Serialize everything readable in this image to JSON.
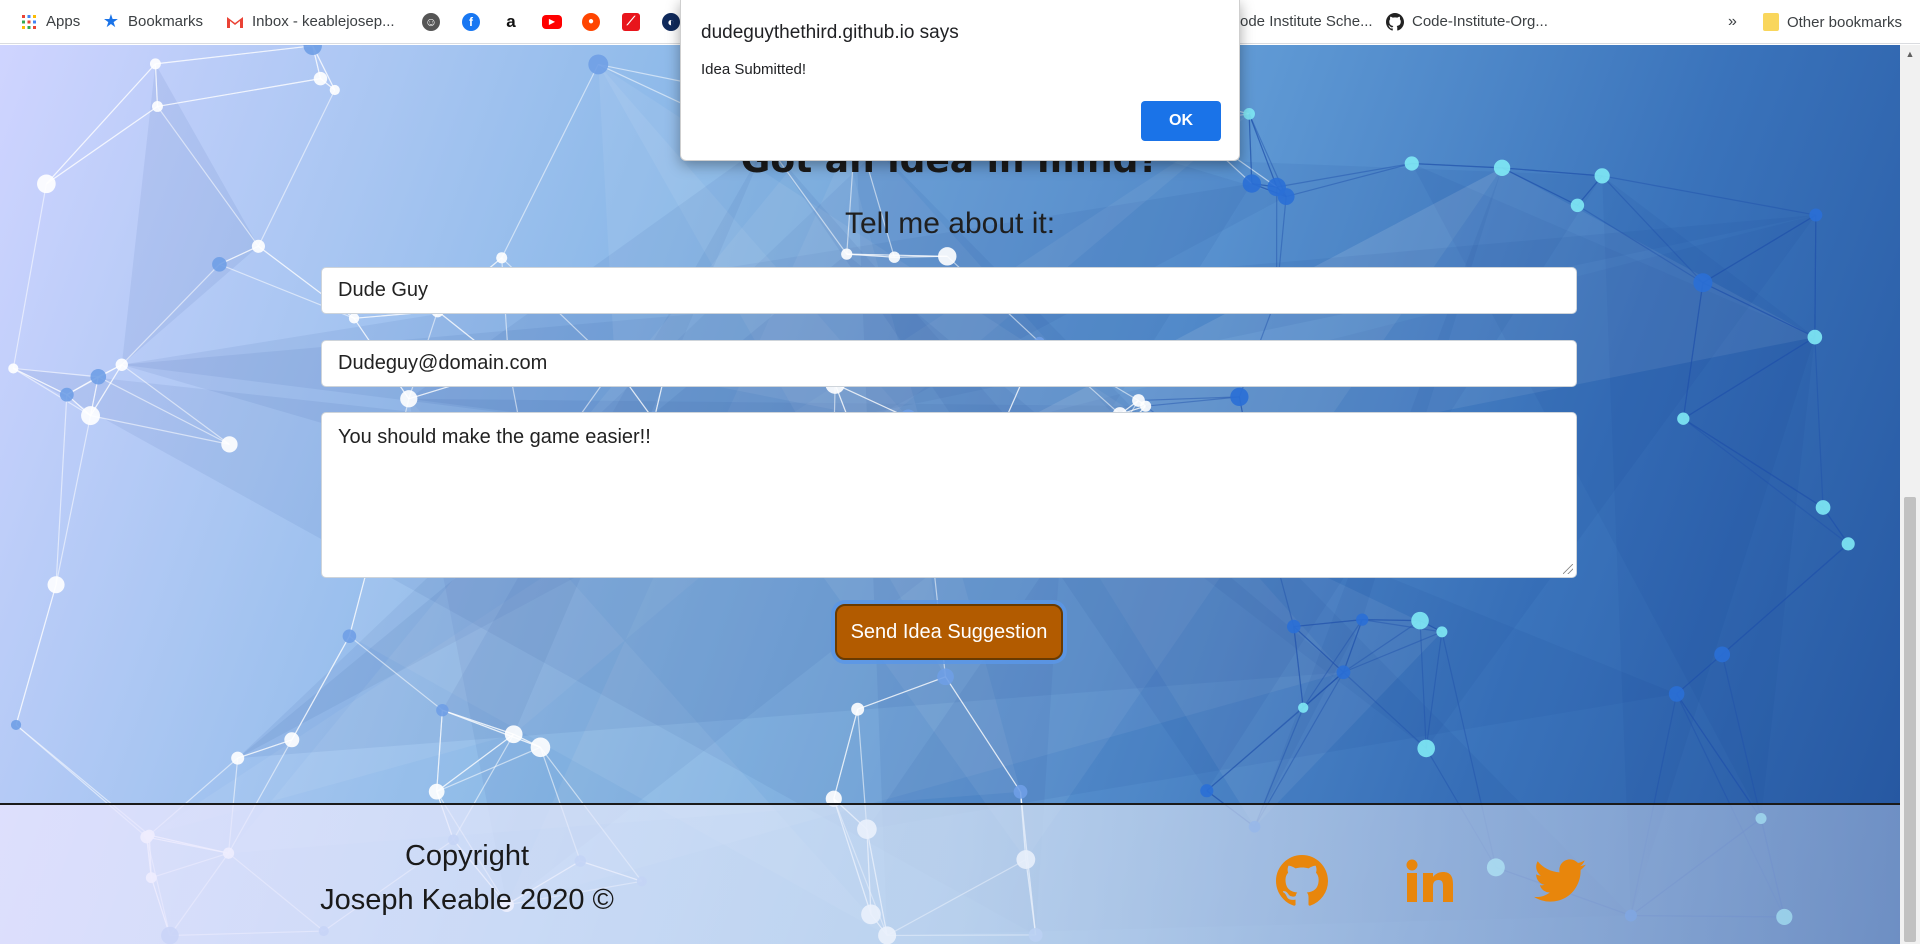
{
  "bookmarks_bar": {
    "items": [
      {
        "label": "Apps",
        "icon": "apps-grid-icon"
      },
      {
        "label": "Bookmarks",
        "icon": "star-icon"
      },
      {
        "label": "Inbox - keablejosep...",
        "icon": "gmail-icon"
      },
      {
        "label": "",
        "icon": "site-icon"
      },
      {
        "label": "",
        "icon": "facebook-icon"
      },
      {
        "label": "",
        "icon": "amazon-icon"
      },
      {
        "label": "",
        "icon": "youtube-icon"
      },
      {
        "label": "",
        "icon": "reddit-icon"
      },
      {
        "label": "",
        "icon": "red-square-icon"
      },
      {
        "label": "",
        "icon": "dark-circle-icon"
      },
      {
        "label": "ode Institute Sche...",
        "icon": ""
      },
      {
        "label": "Code-Institute-Org...",
        "icon": "github-icon"
      }
    ],
    "overflow": "»",
    "other_bookmarks": "Other bookmarks"
  },
  "dialog": {
    "title": "dudeguythethird.github.io says",
    "message": "Idea Submitted!",
    "ok_label": "OK"
  },
  "main": {
    "heading": "Got an idea in mind?",
    "subheading": "Tell me about it:",
    "name_value": "Dude Guy",
    "email_value": "Dudeguy@domain.com",
    "message_value": "You should make the game easier!!",
    "submit_label": "Send Idea Suggestion"
  },
  "footer": {
    "copyright_line1": "Copyright",
    "copyright_line2": "Joseph Keable 2020 ©",
    "social": [
      "github-icon",
      "linkedin-icon",
      "twitter-icon"
    ],
    "social_color": "#e8860c"
  },
  "colors": {
    "button": "#b25b00",
    "dialog_ok": "#1a73e8"
  }
}
